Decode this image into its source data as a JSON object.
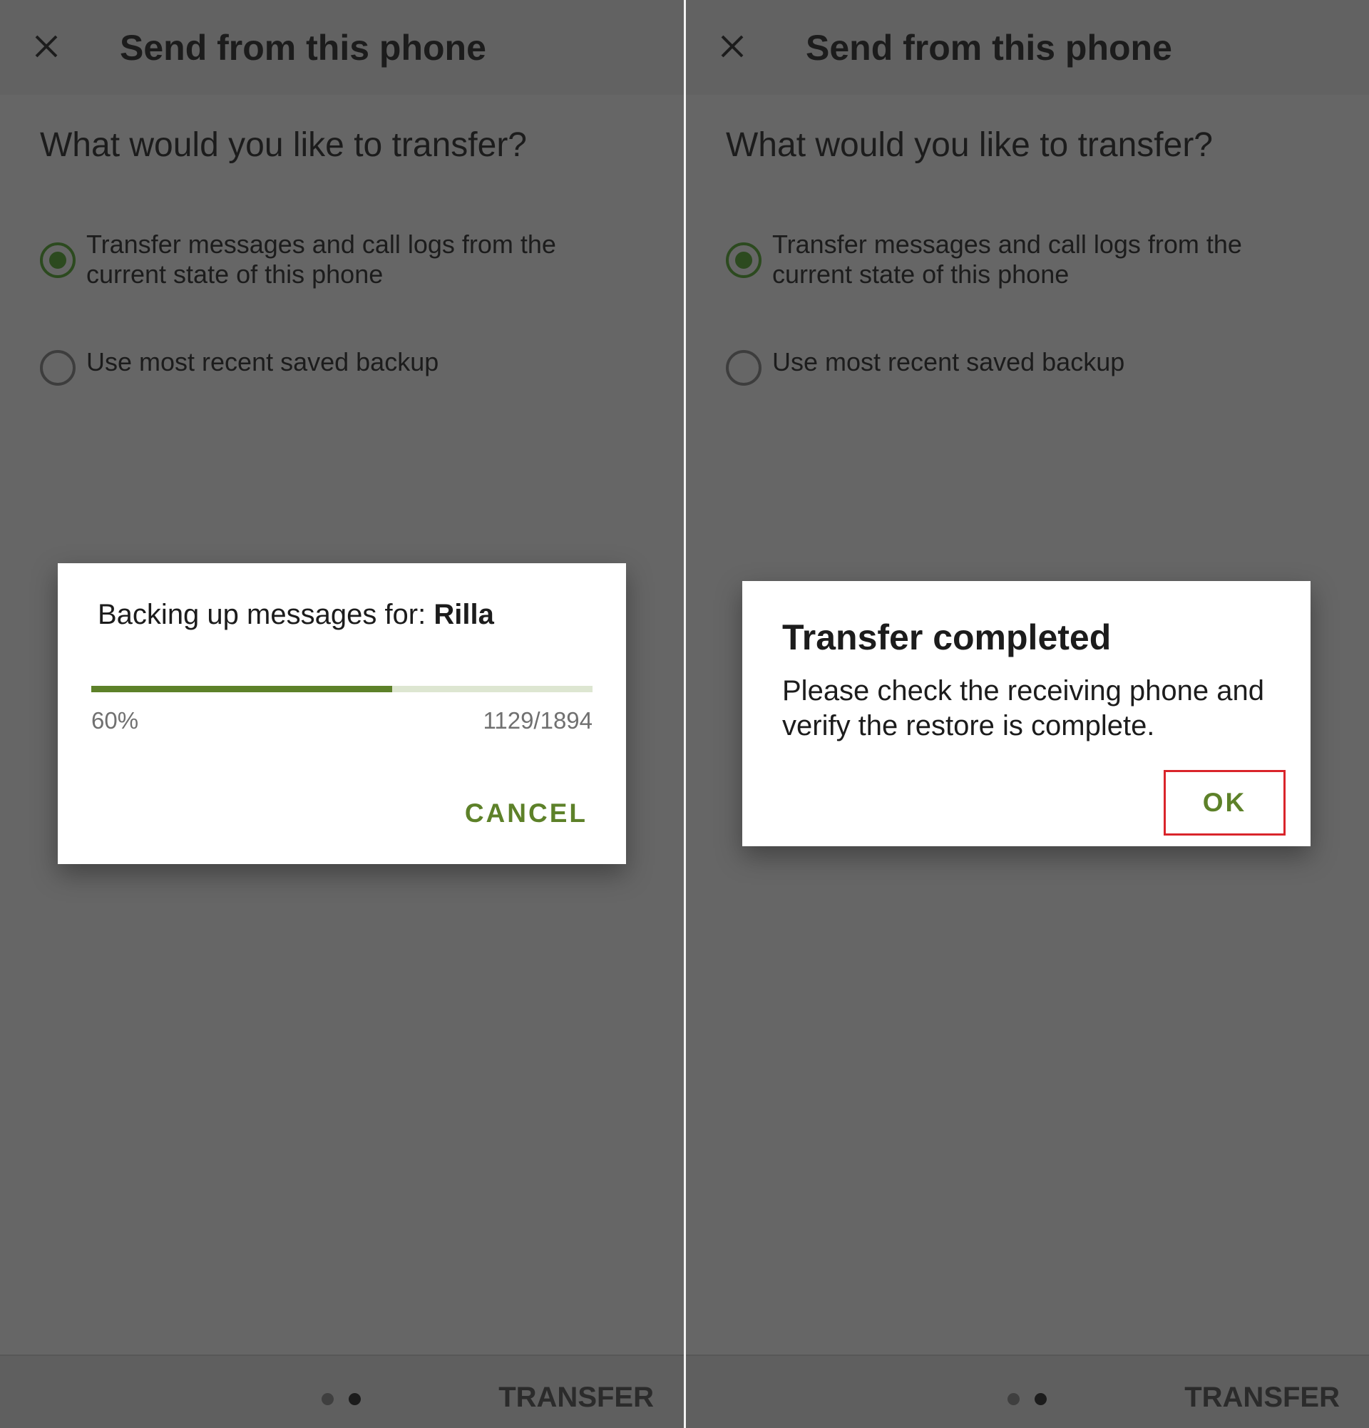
{
  "colors": {
    "background_dim": "#666666",
    "accent_green": "#5d8129",
    "highlight_red": "#d9252b",
    "dialog_bg": "#ffffff"
  },
  "panels": [
    {
      "header": {
        "close_icon": "close-icon",
        "title": "Send from this phone"
      },
      "question": "What would you like to transfer?",
      "options": [
        {
          "label": "Transfer messages and call logs from the current state of this phone",
          "selected": true
        },
        {
          "label": "Use most recent saved backup",
          "selected": false
        }
      ],
      "footer": {
        "page_indicator": {
          "pages": 2,
          "current": 2
        },
        "action_label": "TRANSFER"
      },
      "dialog": {
        "message_prefix": "Backing up messages for: ",
        "contact_name": "Rilla",
        "progress_fraction": 0.6,
        "progress_percent": "60%",
        "progress_count": "1129/1894",
        "cancel_label": "CANCEL"
      }
    },
    {
      "header": {
        "close_icon": "close-icon",
        "title": "Send from this phone"
      },
      "question": "What would you like to transfer?",
      "options": [
        {
          "label": "Transfer messages and call logs from the current state of this phone",
          "selected": true
        },
        {
          "label": "Use most recent saved backup",
          "selected": false
        }
      ],
      "footer": {
        "page_indicator": {
          "pages": 2,
          "current": 2
        },
        "action_label": "TRANSFER"
      },
      "dialog": {
        "title": "Transfer completed",
        "body": "Please check the receiving phone and verify the restore is complete.",
        "ok_label": "OK"
      }
    }
  ]
}
